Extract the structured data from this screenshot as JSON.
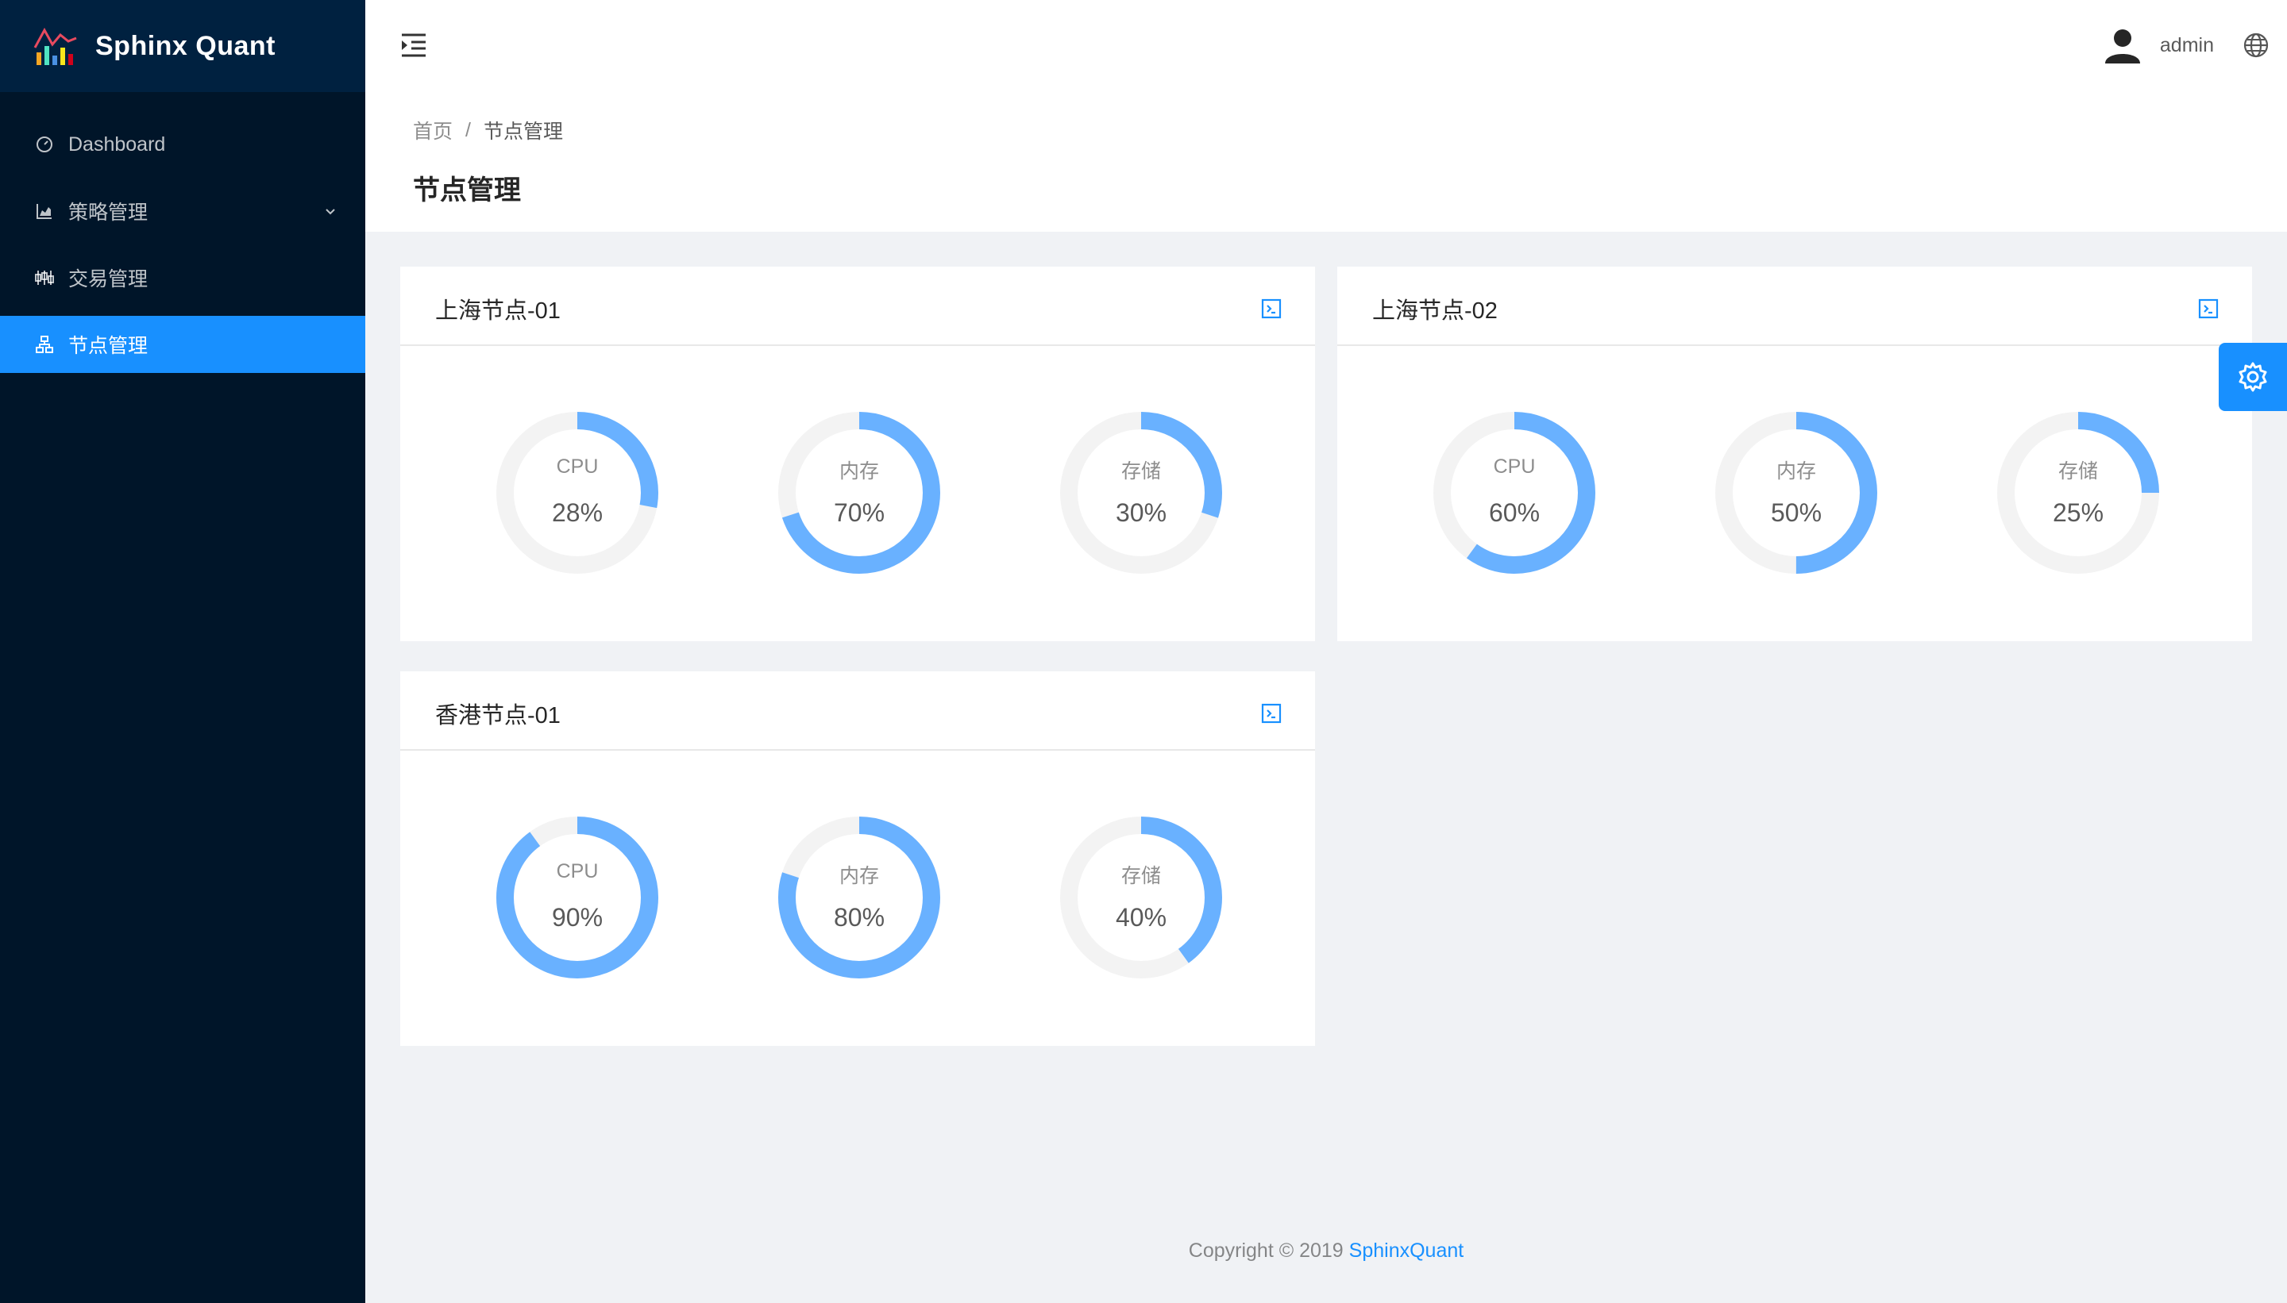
{
  "app": {
    "name": "Sphinx Quant"
  },
  "sidebar": {
    "items": [
      {
        "label": "Dashboard",
        "icon": "dashboard-icon"
      },
      {
        "label": "策略管理",
        "icon": "area-chart-icon",
        "has_submenu": true
      },
      {
        "label": "交易管理",
        "icon": "sliders-icon"
      },
      {
        "label": "节点管理",
        "icon": "cluster-icon",
        "active": true
      }
    ]
  },
  "header": {
    "username": "admin"
  },
  "breadcrumb": {
    "home": "首页",
    "separator": "/",
    "current": "节点管理"
  },
  "page": {
    "title": "节点管理"
  },
  "nodes": [
    {
      "name": "上海节点-01",
      "metrics": [
        {
          "label": "CPU",
          "value": "28%",
          "percent": 28
        },
        {
          "label": "内存",
          "value": "70%",
          "percent": 70
        },
        {
          "label": "存储",
          "value": "30%",
          "percent": 30
        }
      ]
    },
    {
      "name": "上海节点-02",
      "metrics": [
        {
          "label": "CPU",
          "value": "60%",
          "percent": 60
        },
        {
          "label": "内存",
          "value": "50%",
          "percent": 50
        },
        {
          "label": "存储",
          "value": "25%",
          "percent": 25
        }
      ]
    },
    {
      "name": "香港节点-01",
      "metrics": [
        {
          "label": "CPU",
          "value": "90%",
          "percent": 90
        },
        {
          "label": "内存",
          "value": "80%",
          "percent": 80
        },
        {
          "label": "存储",
          "value": "40%",
          "percent": 40
        }
      ]
    }
  ],
  "footer": {
    "copyright": "Copyright © 2019",
    "brand": "SphinxQuant"
  },
  "colors": {
    "primary": "#1890ff",
    "gauge_fill": "#69b1ff",
    "gauge_track": "#f3f3f3",
    "sidebar_bg": "#001529"
  }
}
